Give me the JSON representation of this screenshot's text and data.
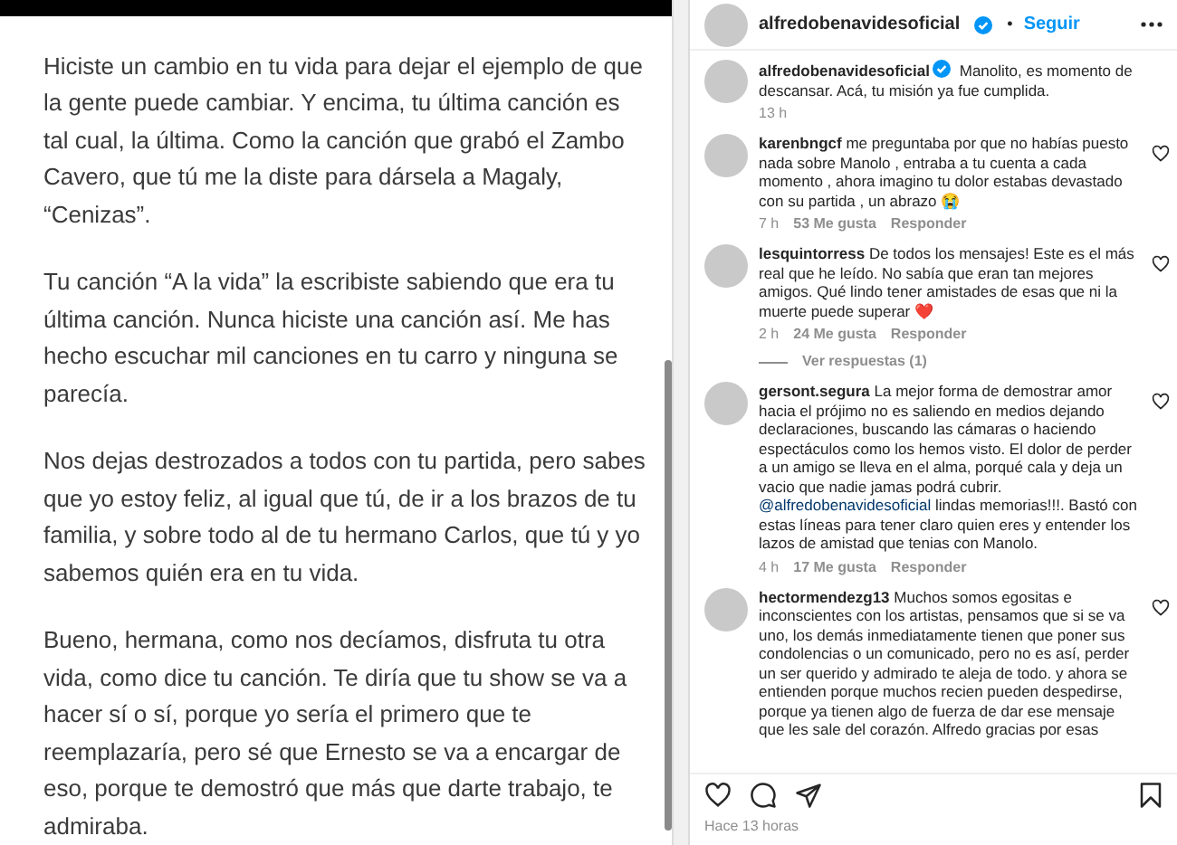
{
  "article": {
    "paragraphs": [
      "Hiciste un cambio en tu vida para dejar el ejemplo de que la gente puede cambiar. Y encima, tu última canción es tal cual, la última. Como la canción que grabó el Zambo Cavero, que tú me la diste para dársela a Magaly, “Cenizas”.",
      "Tu canción “A la vida” la escribiste sabiendo que era tu última canción. Nunca hiciste una canción así. Me has hecho escuchar mil canciones en tu carro y ninguna se parecía.",
      "Nos dejas destrozados a todos con tu partida, pero sabes que yo estoy feliz, al igual que tú, de ir a los brazos de tu familia, y sobre todo al de tu hermano Carlos, que tú y yo sabemos quién era en tu vida.",
      "Bueno, hermana, como nos decíamos, disfruta tu otra vida, como dice tu canción. Te diría que tu show se va a hacer sí o sí, porque yo sería el primero que te reemplazaría, pero sé que Ernesto se va a encargar de eso, porque te demostró que más que darte trabajo, te admiraba."
    ]
  },
  "post": {
    "header": {
      "username": "alfredobenavidesoficial",
      "verified": true,
      "separator": "•",
      "follow": "Seguir"
    },
    "caption": {
      "username": "alfredobenavidesoficial",
      "verified": true,
      "text": "Manolito, es momento de descansar. Acá, tu misión ya fue cumplida.",
      "time": "13 h"
    },
    "comments": [
      {
        "username": "karenbngcf",
        "text": "me preguntaba por que no habías puesto nada sobre Manolo , entraba a tu cuenta a cada momento , ahora imagino tu dolor estabas devastado con su partida , un abrazo 😭",
        "time": "7 h",
        "likes": "53 Me gusta",
        "reply": "Responder"
      },
      {
        "username": "lesquintorress",
        "text": "De todos los mensajes! Este es el más real que he leído. No sabía que eran tan mejores amigos. Qué lindo tener amistades de esas que ni la muerte puede superar ❤️",
        "time": "2 h",
        "likes": "24 Me gusta",
        "reply": "Responder",
        "replies": "Ver respuestas (1)"
      },
      {
        "username": "gersont.segura",
        "text": "La mejor forma de demostrar amor hacia el prójimo no es saliendo en medios dejando declaraciones, buscando las cámaras o haciendo espectáculos como los hemos visto. El dolor de perder a un amigo se lleva en el alma, porqué cala y deja un vacio que nadie jamas podrá cubrir.",
        "mention": "@alfredobenavidesoficial",
        "text_after": "lindas memorias!!!. Bastó con estas líneas para tener claro quien eres y entender los lazos de amistad que tenias con Manolo.",
        "time": "4 h",
        "likes": "17 Me gusta",
        "reply": "Responder"
      },
      {
        "username": "hectormendezg13",
        "text": "Muchos somos egositas e inconscientes con los artistas, pensamos que si se va uno, los demás inmediatamente tienen que poner sus condolencias o un comunicado, pero no es así, perder un ser querido y admirado te aleja de todo. y ahora se entienden porque muchos recien pueden despedirse, porque ya tienen algo de fuerza de dar ese mensaje que les sale del corazón. Alfredo gracias por esas"
      }
    ],
    "timestamp": "Hace 13 horas"
  }
}
